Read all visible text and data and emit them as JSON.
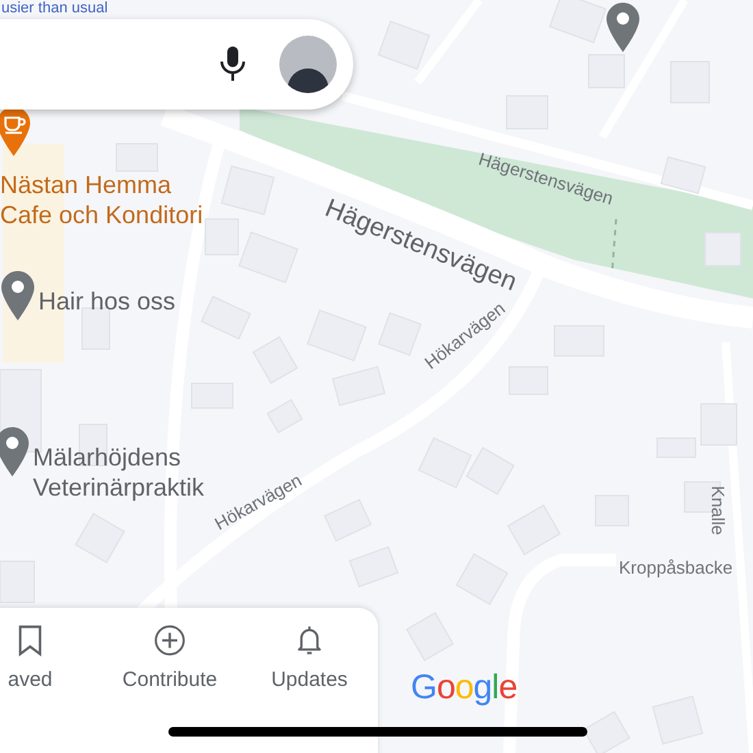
{
  "banner": {
    "text": "usier than usual"
  },
  "streets": [
    {
      "name": "Hägerstensvägen",
      "kind": "major"
    },
    {
      "name": "Hägerstensvägen",
      "kind": "minor"
    },
    {
      "name": "Hökarvägen",
      "kind": "minor"
    },
    {
      "name": "Hökarvägen",
      "kind": "minor"
    },
    {
      "name": "Kroppåsbacke",
      "kind": "minor"
    },
    {
      "name": "Knalle",
      "kind": "minor"
    }
  ],
  "places": [
    {
      "lines": [
        "Nästan Hemma",
        "Cafe och Konditori"
      ],
      "kind": "cafe"
    },
    {
      "lines": [
        "Hair hos oss"
      ],
      "kind": "pin"
    },
    {
      "lines": [
        "Mälarhöjdens",
        "Veterinärpraktik"
      ],
      "kind": "pin"
    }
  ],
  "nav": [
    {
      "label": "aved",
      "kind": "saved",
      "selected": false
    },
    {
      "label": "Contribute",
      "kind": "contribute",
      "selected": false
    },
    {
      "label": "Updates",
      "kind": "updates",
      "selected": false
    }
  ],
  "logo": "Google"
}
